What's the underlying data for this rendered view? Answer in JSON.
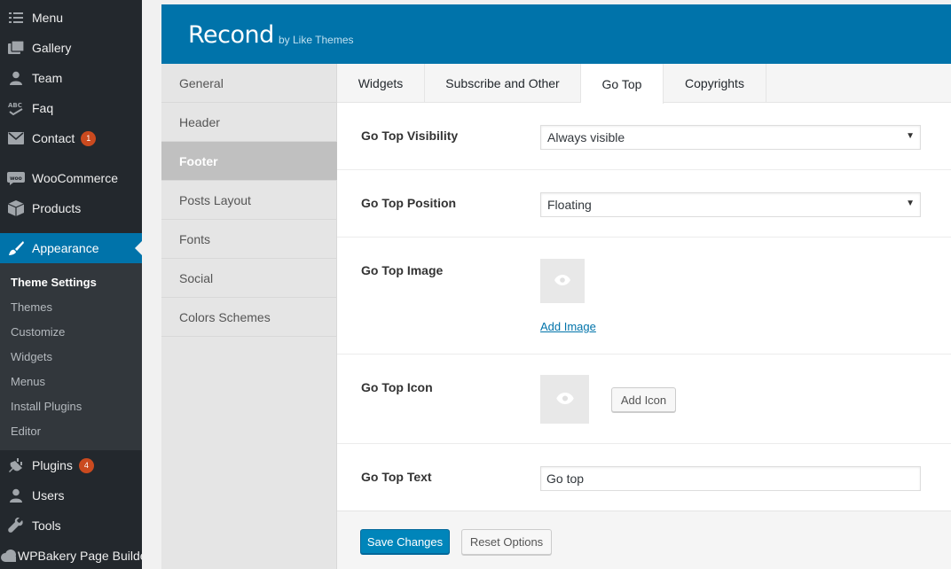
{
  "sidebar": {
    "items": [
      {
        "label": "Menu",
        "icon": "menu-list-icon"
      },
      {
        "label": "Gallery",
        "icon": "gallery-icon"
      },
      {
        "label": "Team",
        "icon": "user-icon"
      },
      {
        "label": "Faq",
        "icon": "abc-icon"
      },
      {
        "label": "Contact",
        "icon": "mail-icon",
        "badge": "1"
      },
      {
        "label": "WooCommerce",
        "icon": "woo-icon"
      },
      {
        "label": "Products",
        "icon": "box-icon"
      },
      {
        "label": "Appearance",
        "icon": "brush-icon"
      },
      {
        "label": "Plugins",
        "icon": "plug-icon",
        "badge": "4"
      },
      {
        "label": "Users",
        "icon": "user-icon"
      },
      {
        "label": "Tools",
        "icon": "wrench-icon"
      },
      {
        "label": "WPBakery Page Builder",
        "icon": "cloud-icon"
      }
    ],
    "submenu": [
      "Theme Settings",
      "Themes",
      "Customize",
      "Widgets",
      "Menus",
      "Install Plugins",
      "Editor"
    ]
  },
  "panel": {
    "title": "Recond",
    "subtitle": "by Like Themes"
  },
  "nav": [
    "General",
    "Header",
    "Footer",
    "Posts Layout",
    "Fonts",
    "Social",
    "Colors Schemes"
  ],
  "tabs": [
    "Widgets",
    "Subscribe and Other",
    "Go Top",
    "Copyrights"
  ],
  "fields": {
    "visibility": {
      "label": "Go Top Visibility",
      "value": "Always visible"
    },
    "position": {
      "label": "Go Top Position",
      "value": "Floating"
    },
    "image": {
      "label": "Go Top Image",
      "link": "Add Image"
    },
    "icon": {
      "label": "Go Top Icon",
      "button": "Add Icon"
    },
    "text": {
      "label": "Go Top Text",
      "value": "Go top"
    }
  },
  "actions": {
    "save": "Save Changes",
    "reset": "Reset Options"
  },
  "colors": {
    "accent": "#0073aa",
    "sidebar_bg": "#23282d",
    "badge": "#ca4a1f"
  }
}
